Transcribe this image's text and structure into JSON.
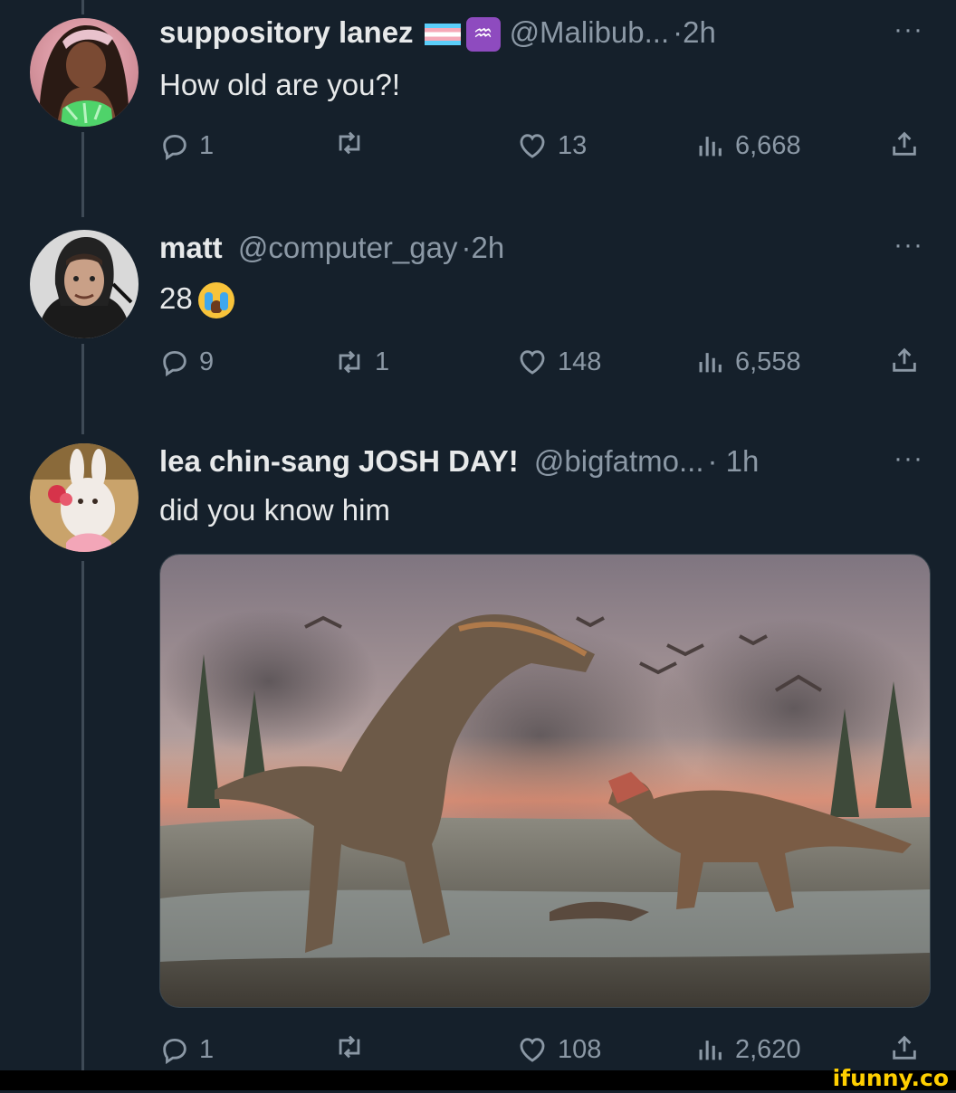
{
  "tweets": [
    {
      "name": "suppository lanez",
      "handle": "@Malibub...",
      "time": "·2h",
      "text": "How old are you?!",
      "badges": [
        "transgender-flag",
        "aquarius-symbol"
      ],
      "aquarius_glyph": "♒",
      "more": "···",
      "replies": "1",
      "reposts": "",
      "likes": "13",
      "views": "6,668"
    },
    {
      "name": "matt",
      "handle": "@computer_gay",
      "time": "·2h",
      "text": "28",
      "emoji": "loudly-crying-face",
      "more": "···",
      "replies": "9",
      "reposts": "1",
      "likes": "148",
      "views": "6,558"
    },
    {
      "name": "lea chin-sang JOSH DAY!",
      "handle": "@bigfatmo...",
      "time": "· 1h",
      "text": "did you know him",
      "more": "···",
      "media": "dinosaur-illustration",
      "replies": "1",
      "reposts": "",
      "likes": "108",
      "views": "2,620"
    }
  ],
  "watermark": "ifunny.co",
  "colors": {
    "background": "#15202b",
    "text": "#e7e9ea",
    "muted": "#8b98a5",
    "watermark": "#ffcf00"
  }
}
